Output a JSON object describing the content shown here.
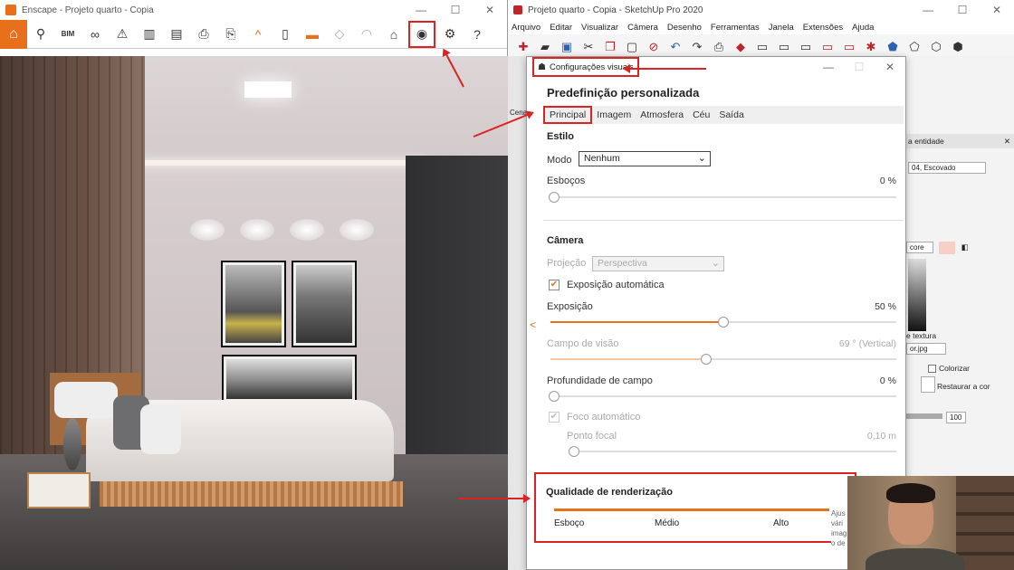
{
  "enscape": {
    "title": "Enscape - Projeto quarto - Copia",
    "bim_label": "BIM",
    "window_controls": [
      "—",
      "☐",
      "✕"
    ]
  },
  "sketchup": {
    "title": "Projeto quarto - Copia - SketchUp Pro 2020",
    "window_controls": [
      "—",
      "☐",
      "✕"
    ],
    "menu": [
      "Arquivo",
      "Editar",
      "Visualizar",
      "Câmera",
      "Desenho",
      "Ferramentas",
      "Janela",
      "Extensões",
      "Ajuda"
    ],
    "right_panel": {
      "entity_label": "a entidade",
      "material_name": "04, Escovado",
      "color_label": "core",
      "texture_label": "e textura",
      "texture_file": "or.jpg",
      "colorize_label": "Colorizar",
      "restore_label": "Restaurar a cor",
      "opacity_value": "100"
    },
    "left_strip": {
      "tab_label": "Cena"
    }
  },
  "dialog": {
    "title": "Configurações visuais",
    "window_controls": [
      "—",
      "☐",
      "✕"
    ],
    "preset_heading": "Predefinição personalizada",
    "tabs": [
      {
        "label": "Principal",
        "active": true
      },
      {
        "label": "Imagem",
        "active": false
      },
      {
        "label": "Atmosfera",
        "active": false
      },
      {
        "label": "Céu",
        "active": false
      },
      {
        "label": "Saída",
        "active": false
      }
    ],
    "style": {
      "heading": "Estilo",
      "mode_label": "Modo",
      "mode_value": "Nenhum",
      "sketch_label": "Esboços",
      "sketch_value": "0 %",
      "sketch_level": 0
    },
    "camera": {
      "heading": "Câmera",
      "projection_label": "Projeção",
      "projection_value": "Perspectiva",
      "auto_exposure_label": "Exposição automática",
      "auto_exposure_checked": true,
      "exposure_label": "Exposição",
      "exposure_value": "50 %",
      "exposure_level": 0.5,
      "fov_label": "Campo de visão",
      "fov_value": "69  ° (Vertical)",
      "fov_level": 0.45,
      "dof_label": "Profundidade de campo",
      "dof_value": "0 %",
      "dof_level": 0,
      "autofocus_label": "Foco automático",
      "autofocus_checked": true,
      "focal_point_label": "Ponto focal",
      "focal_point_value": "0,10  m",
      "focal_point_level": 0
    },
    "quality": {
      "heading": "Qualidade de renderização",
      "levels": [
        "Esboço",
        "Médio",
        "Alto"
      ],
      "tooltip": "Ajus vári imag o de"
    }
  },
  "colors": {
    "accent": "#e8701a",
    "annotation": "#dd2222",
    "sketchup_red": "#c0242b"
  }
}
